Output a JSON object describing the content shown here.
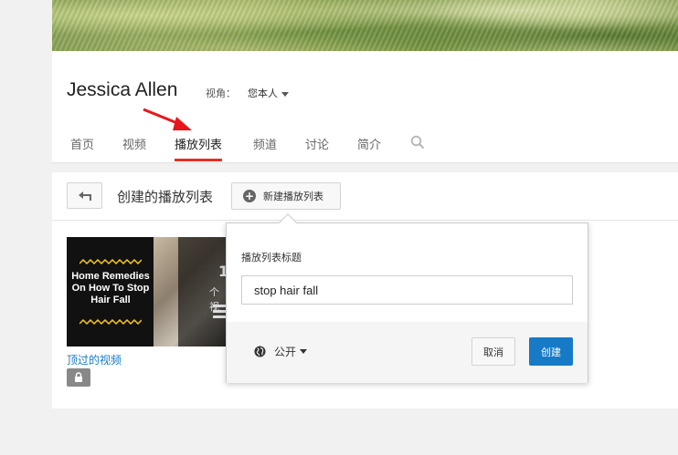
{
  "channel": {
    "name": "Jessica Allen",
    "view_as_label": "视角：",
    "view_as_value": "您本人"
  },
  "tabs": [
    {
      "label": "首页"
    },
    {
      "label": "视频"
    },
    {
      "label": "播放列表"
    },
    {
      "label": "频道"
    },
    {
      "label": "讨论"
    },
    {
      "label": "简介"
    }
  ],
  "active_tab": "播放列表",
  "section": {
    "title": "创建的播放列表",
    "new_playlist_button": "新建播放列表"
  },
  "playlist_card": {
    "thumbnail_text": "Home Remedies On How To Stop Hair Fall",
    "video_count": "1",
    "count_label": "个视",
    "link_text": "顶过的视频"
  },
  "new_playlist_popup": {
    "title_label": "播放列表标题",
    "title_value": "stop hair fall",
    "privacy_value": "公开",
    "cancel_label": "取消",
    "create_label": "创建"
  },
  "colors": {
    "accent_red": "#e52d27",
    "link_blue": "#167ac6",
    "thumb_zigzag": "#f5c518"
  }
}
